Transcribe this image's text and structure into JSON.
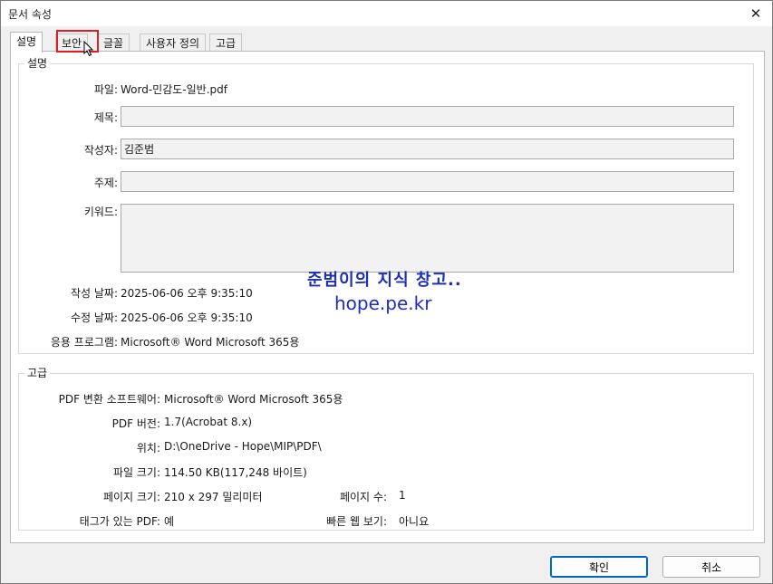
{
  "window": {
    "title": "문서 속성",
    "close_glyph": "✕"
  },
  "tabs": [
    {
      "label": "설명",
      "active": true
    },
    {
      "label": "보안",
      "active": false
    },
    {
      "label": "글꼴",
      "active": false
    },
    {
      "label": "사용자 정의",
      "active": false
    },
    {
      "label": "고급",
      "active": false
    }
  ],
  "description": {
    "legend": "설명",
    "file_label": "파일:",
    "file_value": "Word-민감도-일반.pdf",
    "title_label": "제목:",
    "title_value": "",
    "author_label": "작성자:",
    "author_value": "김준범",
    "subject_label": "주제:",
    "subject_value": "",
    "keywords_label": "키워드:",
    "keywords_value": "",
    "created_label": "작성 날짜:",
    "created_value": "2025-06-06 오후 9:35:10",
    "modified_label": "수정 날짜:",
    "modified_value": "2025-06-06 오후 9:35:10",
    "app_label": "응용 프로그램:",
    "app_value": "Microsoft® Word Microsoft 365용"
  },
  "advanced": {
    "legend": "고급",
    "producer_label": "PDF 변환 소프트웨어:",
    "producer_value": "Microsoft® Word Microsoft 365용",
    "version_label": "PDF 버전:",
    "version_value": "1.7(Acrobat 8.x)",
    "location_label": "위치:",
    "location_value": "D:\\OneDrive - Hope\\MIP\\PDF\\",
    "filesize_label": "파일 크기:",
    "filesize_value": "114.50 KB(117,248 바이트)",
    "pagesize_label": "페이지 크기:",
    "pagesize_value": "210 x 297 밀리미터",
    "pagecount_label": "페이지 수:",
    "pagecount_value": "1",
    "tagged_label": "태그가 있는 PDF:",
    "tagged_value": "예",
    "fastweb_label": "빠른 웹 보기:",
    "fastweb_value": "아니요"
  },
  "watermark": {
    "line1": "준범이의 지식 창고..",
    "line2": "hope.pe.kr"
  },
  "buttons": {
    "ok": "확인",
    "cancel": "취소"
  },
  "colors": {
    "highlight": "#d9202a",
    "watermark": "#1c2fb8",
    "accent": "#0067c0"
  }
}
